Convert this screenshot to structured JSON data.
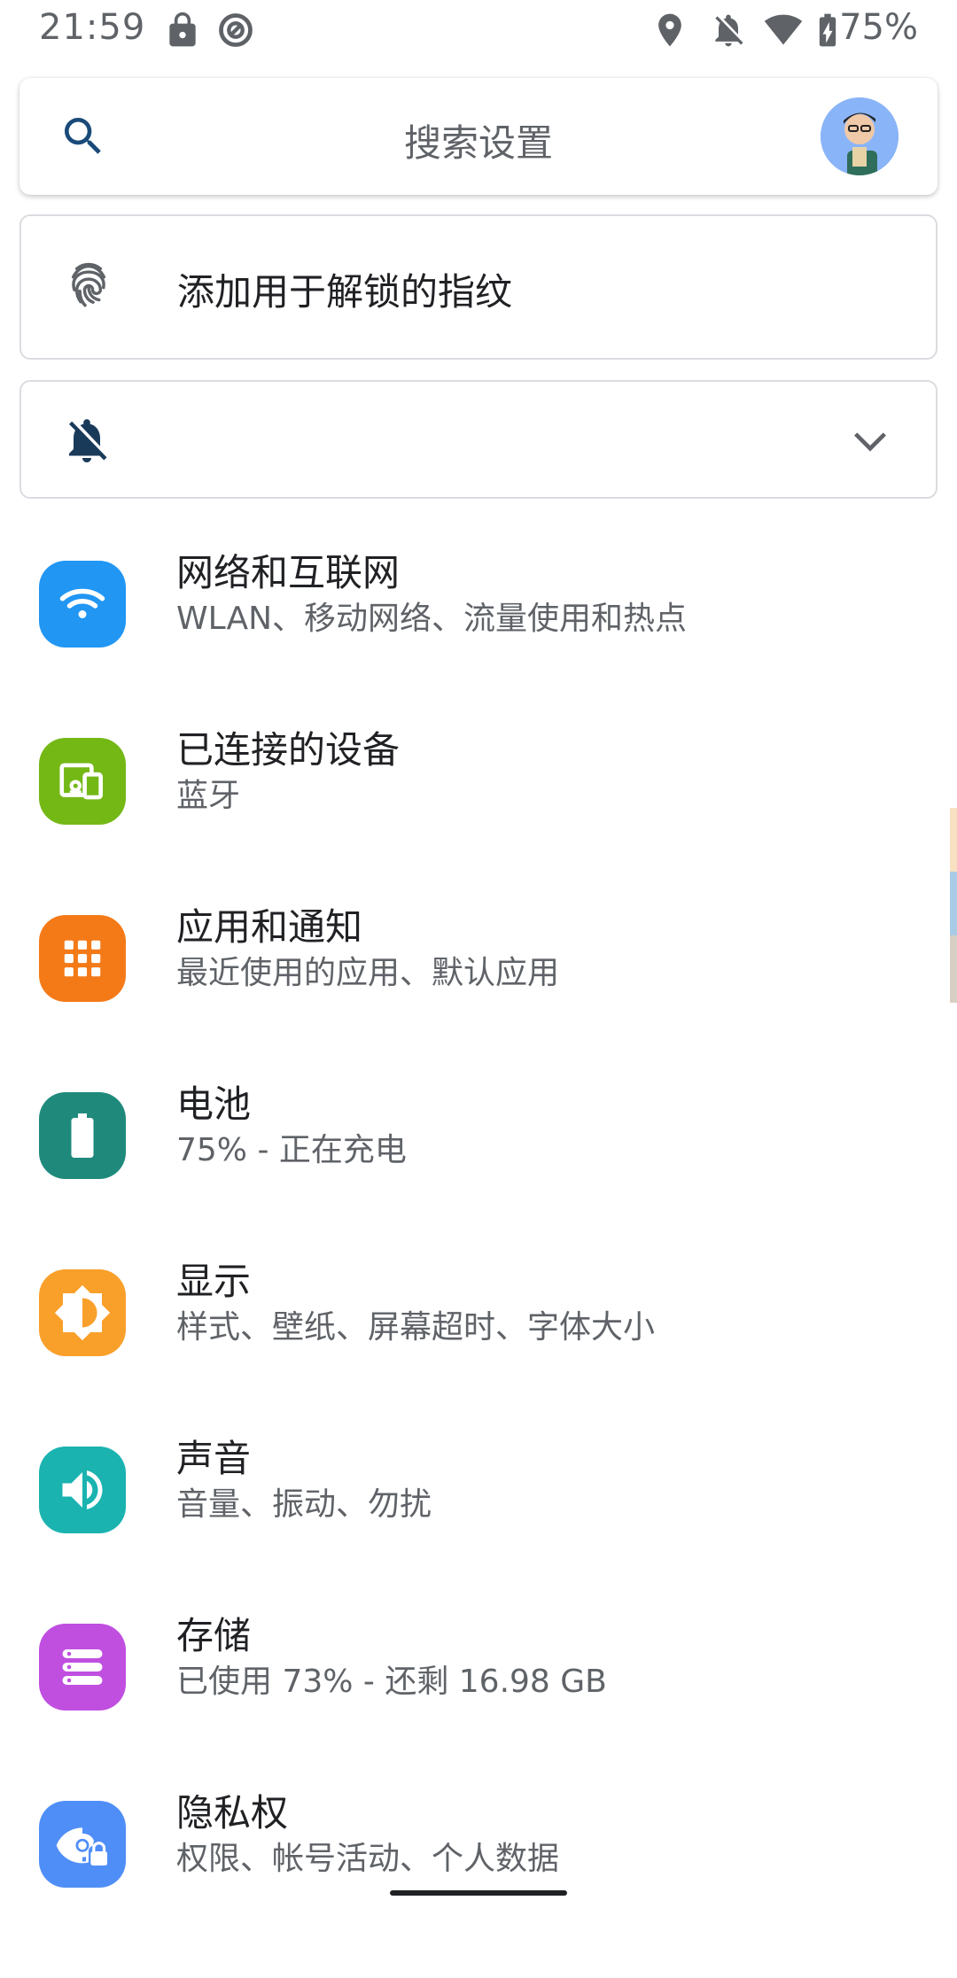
{
  "status_bar": {
    "time": "21:59",
    "battery_percent": "75%",
    "icons": [
      "lock-icon",
      "sync-icon",
      "location-icon",
      "notifications-off-icon",
      "wifi-icon",
      "battery-charging-icon"
    ]
  },
  "search": {
    "placeholder": "搜索设置",
    "icon": "search-icon",
    "avatar": "avatar"
  },
  "suggestions": {
    "fingerprint": {
      "label": "添加用于解锁的指纹",
      "icon": "fingerprint-icon"
    },
    "dnd": {
      "icon": "notifications-off-icon",
      "expand_icon": "chevron-down-icon"
    }
  },
  "settings": [
    {
      "id": "network",
      "title": "网络和互联网",
      "subtitle": "WLAN、移动网络、流量使用和热点",
      "icon": "wifi-icon",
      "color": "#2196f3"
    },
    {
      "id": "connected",
      "title": "已连接的设备",
      "subtitle": "蓝牙",
      "icon": "devices-icon",
      "color": "#74b816"
    },
    {
      "id": "apps",
      "title": "应用和通知",
      "subtitle": "最近使用的应用、默认应用",
      "icon": "apps-grid-icon",
      "color": "#f47a18"
    },
    {
      "id": "battery",
      "title": "电池",
      "subtitle": "75% - 正在充电",
      "icon": "battery-icon",
      "color": "#1f8a7c"
    },
    {
      "id": "display",
      "title": "显示",
      "subtitle": "样式、壁纸、屏幕超时、字体大小",
      "icon": "brightness-icon",
      "color": "#f9a02a"
    },
    {
      "id": "sound",
      "title": "声音",
      "subtitle": "音量、振动、勿扰",
      "icon": "volume-icon",
      "color": "#1ab3b0"
    },
    {
      "id": "storage",
      "title": "存储",
      "subtitle": "已使用 73% - 还剩 16.98 GB",
      "icon": "storage-icon",
      "color": "#c04fe0"
    },
    {
      "id": "privacy",
      "title": "隐私权",
      "subtitle": "权限、帐号活动、个人数据",
      "icon": "privacy-eye-icon",
      "color": "#4f8ef7"
    }
  ],
  "colors": {
    "edge_strip": [
      "#f7e1c2",
      "#a9cbe6",
      "#d8cfc4"
    ]
  }
}
